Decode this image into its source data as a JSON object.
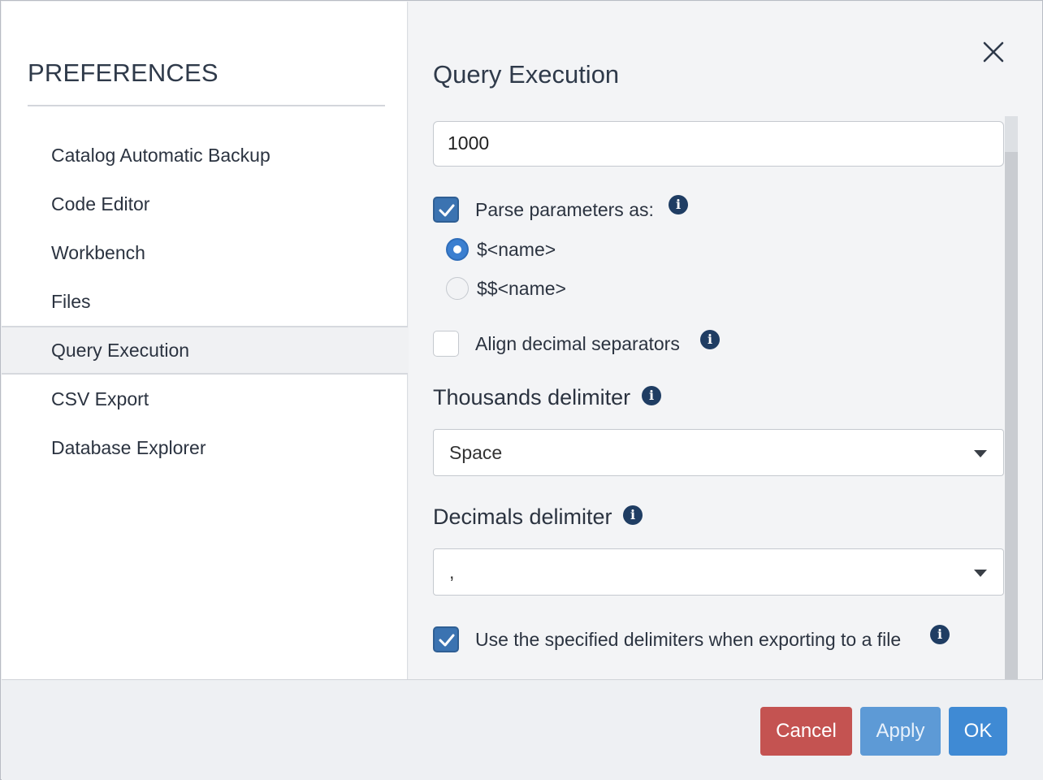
{
  "sidebar": {
    "title": "PREFERENCES",
    "items": [
      {
        "label": "Catalog Automatic Backup"
      },
      {
        "label": "Code Editor"
      },
      {
        "label": "Workbench"
      },
      {
        "label": "Files"
      },
      {
        "label": "Query Execution",
        "active": true
      },
      {
        "label": "CSV Export"
      },
      {
        "label": "Database Explorer"
      }
    ]
  },
  "content": {
    "title": "Query Execution",
    "max_rows_value": "1000",
    "parse_parameters": {
      "label": "Parse parameters as:",
      "checked": true
    },
    "radio_options": [
      {
        "label": "$<name>",
        "selected": true
      },
      {
        "label": "$$<name>",
        "selected": false
      }
    ],
    "align_decimal": {
      "label": "Align decimal separators",
      "checked": false
    },
    "thousands": {
      "label": "Thousands delimiter",
      "value": "Space"
    },
    "decimals": {
      "label": "Decimals delimiter",
      "value": ","
    },
    "use_delimiters": {
      "label": "Use the specified delimiters when exporting to a file",
      "checked": true
    }
  },
  "footer": {
    "cancel_label": "Cancel",
    "apply_label": "Apply",
    "ok_label": "OK"
  },
  "colors": {
    "accent": "#3b73b1",
    "cancel": "#c45351",
    "apply": "#5d9ad6",
    "ok": "#3f8ad4",
    "info_icon": "#1f3d63"
  },
  "icons": {
    "close": "close-icon",
    "info": "info-icon",
    "checkmark": "checkmark-icon",
    "dropdown": "caret-down-icon"
  }
}
